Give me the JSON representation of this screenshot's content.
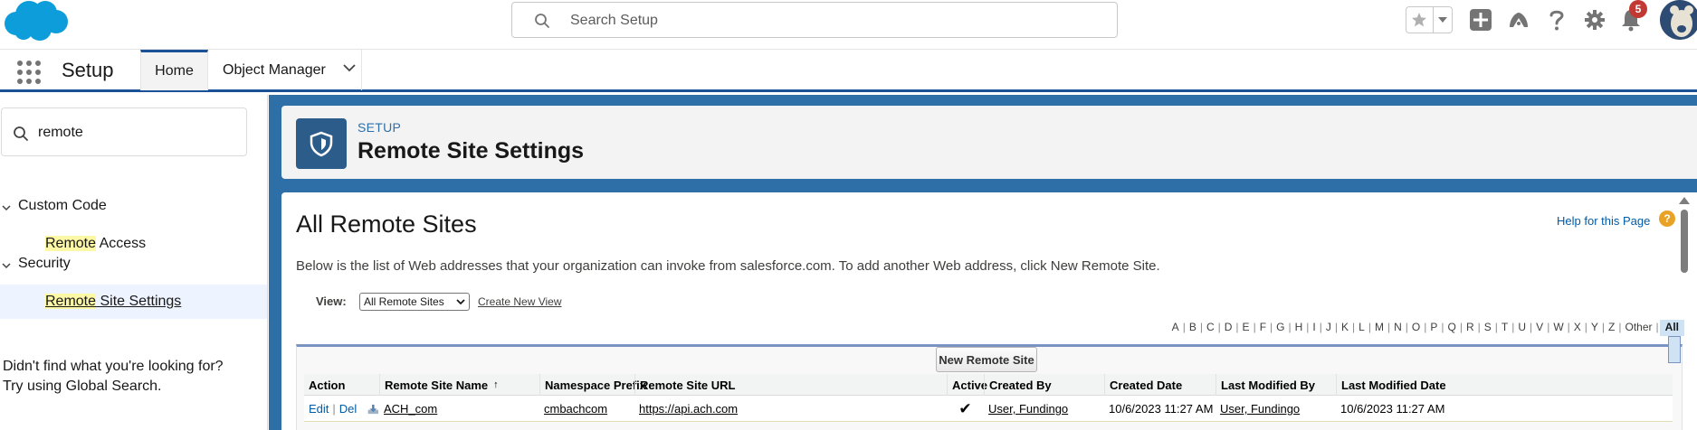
{
  "global_header": {
    "search_placeholder": "Search Setup",
    "notification_count": "5"
  },
  "context_bar": {
    "app_name": "Setup",
    "tabs": [
      {
        "label": "Home"
      },
      {
        "label": "Object Manager"
      }
    ]
  },
  "sidebar": {
    "quickfind_value": "remote",
    "groups": [
      {
        "label": "Custom Code",
        "items": [
          {
            "highlight": "Remote",
            "rest": " Access"
          }
        ]
      },
      {
        "label": "Security",
        "items": [
          {
            "highlight": "Remote",
            "rest": " Site Settings"
          }
        ]
      }
    ],
    "not_found_line1": "Didn't find what you're looking for?",
    "not_found_line2": "Try using Global Search."
  },
  "page_header": {
    "eyebrow": "SETUP",
    "title": "Remote Site Settings"
  },
  "content": {
    "title": "All Remote Sites",
    "help_link": "Help for this Page",
    "description": "Below is the list of Web addresses that your organization can invoke from salesforce.com. To add another Web address, click New Remote Site.",
    "view_label": "View:",
    "view_selected": "All Remote Sites",
    "create_view": "Create New View",
    "alpha_letters": [
      "A",
      "B",
      "C",
      "D",
      "E",
      "F",
      "G",
      "H",
      "I",
      "J",
      "K",
      "L",
      "M",
      "N",
      "O",
      "P",
      "Q",
      "R",
      "S",
      "T",
      "U",
      "V",
      "W",
      "X",
      "Y",
      "Z",
      "Other"
    ],
    "alpha_all": "All",
    "new_button": "New Remote Site",
    "columns": [
      "Action",
      "Remote Site Name",
      "Namespace Prefix",
      "Remote Site URL",
      "Active",
      "Created By",
      "Created Date",
      "Last Modified By",
      "Last Modified Date"
    ],
    "rows": [
      {
        "edit": "Edit",
        "del": "Del",
        "name": "ACH_com",
        "namespace": "cmbachcom",
        "url": "https://api.ach.com",
        "active": "✔",
        "created_by": "User, Fundingo",
        "created_date": "10/6/2023 11:27 AM",
        "modified_by": "User, Fundingo",
        "modified_date": "10/6/2023 11:27 AM"
      }
    ]
  },
  "colors": {
    "brand": "#1b5297",
    "background_blue": "#2e6fa7",
    "link": "#015ba7",
    "highlight": "#fdf8a6"
  }
}
